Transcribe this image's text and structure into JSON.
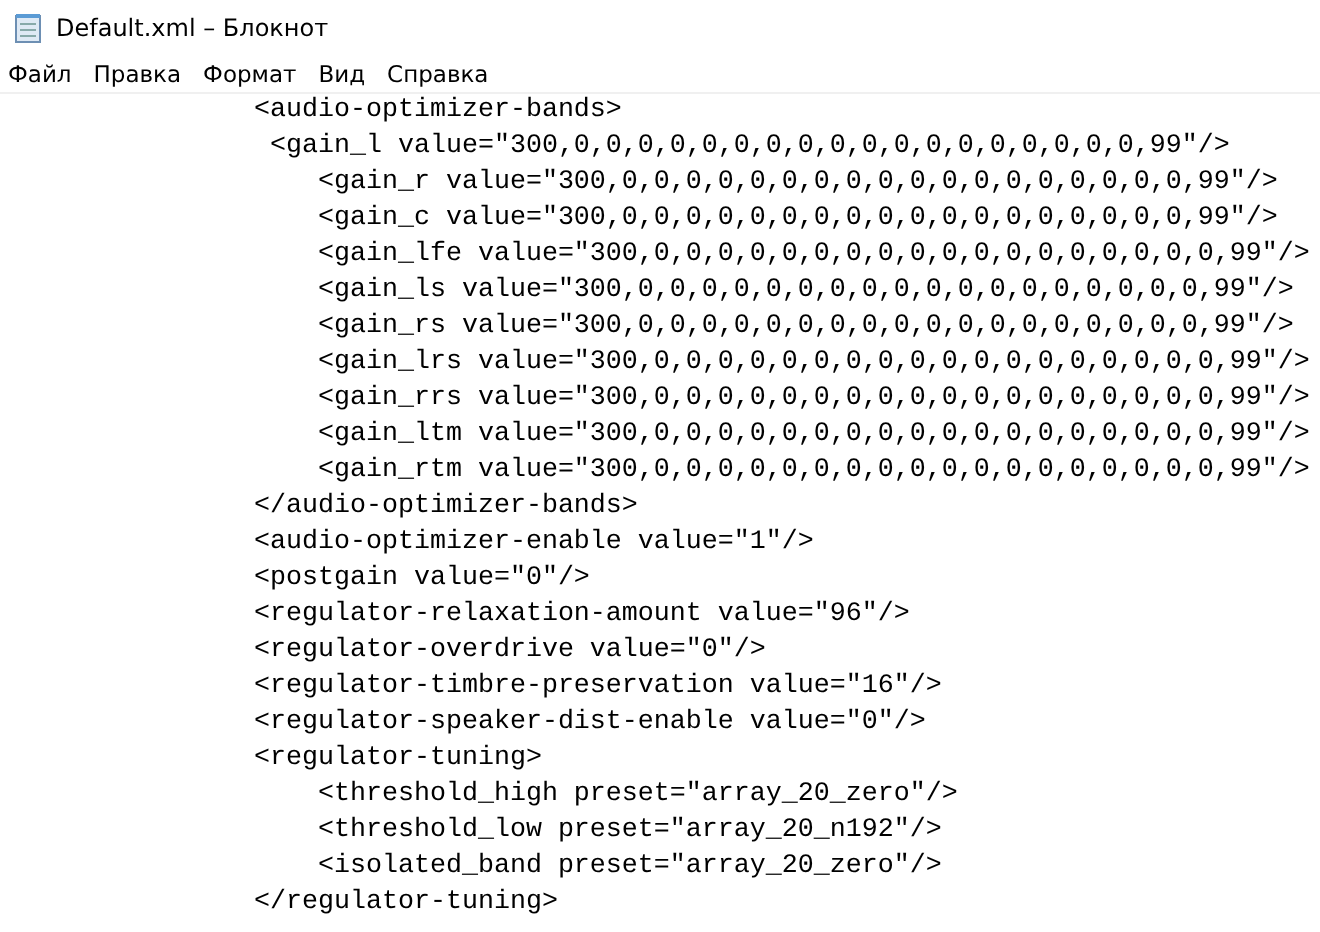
{
  "window": {
    "title": "Default.xml – Блокнот"
  },
  "menu": [
    "Файл",
    "Правка",
    "Формат",
    "Вид",
    "Справка"
  ],
  "editor": {
    "lines": [
      "               <audio-optimizer-bands>",
      "                <gain_l value=\"300,0,0,0,0,0,0,0,0,0,0,0,0,0,0,0,0,0,0,99\"/>",
      "                   <gain_r value=\"300,0,0,0,0,0,0,0,0,0,0,0,0,0,0,0,0,0,0,99\"/>",
      "                   <gain_c value=\"300,0,0,0,0,0,0,0,0,0,0,0,0,0,0,0,0,0,0,99\"/>",
      "                   <gain_lfe value=\"300,0,0,0,0,0,0,0,0,0,0,0,0,0,0,0,0,0,0,99\"/>",
      "                   <gain_ls value=\"300,0,0,0,0,0,0,0,0,0,0,0,0,0,0,0,0,0,0,99\"/>",
      "                   <gain_rs value=\"300,0,0,0,0,0,0,0,0,0,0,0,0,0,0,0,0,0,0,99\"/>",
      "                   <gain_lrs value=\"300,0,0,0,0,0,0,0,0,0,0,0,0,0,0,0,0,0,0,99\"/>",
      "                   <gain_rrs value=\"300,0,0,0,0,0,0,0,0,0,0,0,0,0,0,0,0,0,0,99\"/>",
      "                   <gain_ltm value=\"300,0,0,0,0,0,0,0,0,0,0,0,0,0,0,0,0,0,0,99\"/>",
      "                   <gain_rtm value=\"300,0,0,0,0,0,0,0,0,0,0,0,0,0,0,0,0,0,0,99\"/>",
      "               </audio-optimizer-bands>",
      "               <audio-optimizer-enable value=\"1\"/>",
      "               <postgain value=\"0\"/>",
      "               <regulator-relaxation-amount value=\"96\"/>",
      "               <regulator-overdrive value=\"0\"/>",
      "               <regulator-timbre-preservation value=\"16\"/>",
      "               <regulator-speaker-dist-enable value=\"0\"/>",
      "               <regulator-tuning>",
      "                   <threshold_high preset=\"array_20_zero\"/>",
      "                   <threshold_low preset=\"array_20_n192\"/>",
      "                   <isolated_band preset=\"array_20_zero\"/>",
      "               </regulator-tuning>"
    ]
  }
}
